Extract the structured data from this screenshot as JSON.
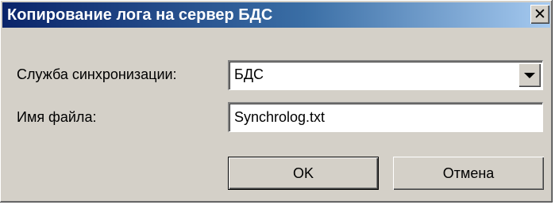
{
  "window": {
    "title": "Копирование лога на сервер БДС",
    "close_glyph": "✕",
    "close_icon": "close-icon"
  },
  "form": {
    "service_label": "Служба синхронизации:",
    "service_value": "БДС",
    "filename_label": "Имя файла:",
    "filename_value": "Synchrolog.txt"
  },
  "buttons": {
    "ok_label": "OK",
    "cancel_label": "Отмена"
  },
  "colors": {
    "titlebar_start": "#0a246a",
    "titlebar_end": "#a6caf0",
    "face": "#d4d0c8"
  }
}
